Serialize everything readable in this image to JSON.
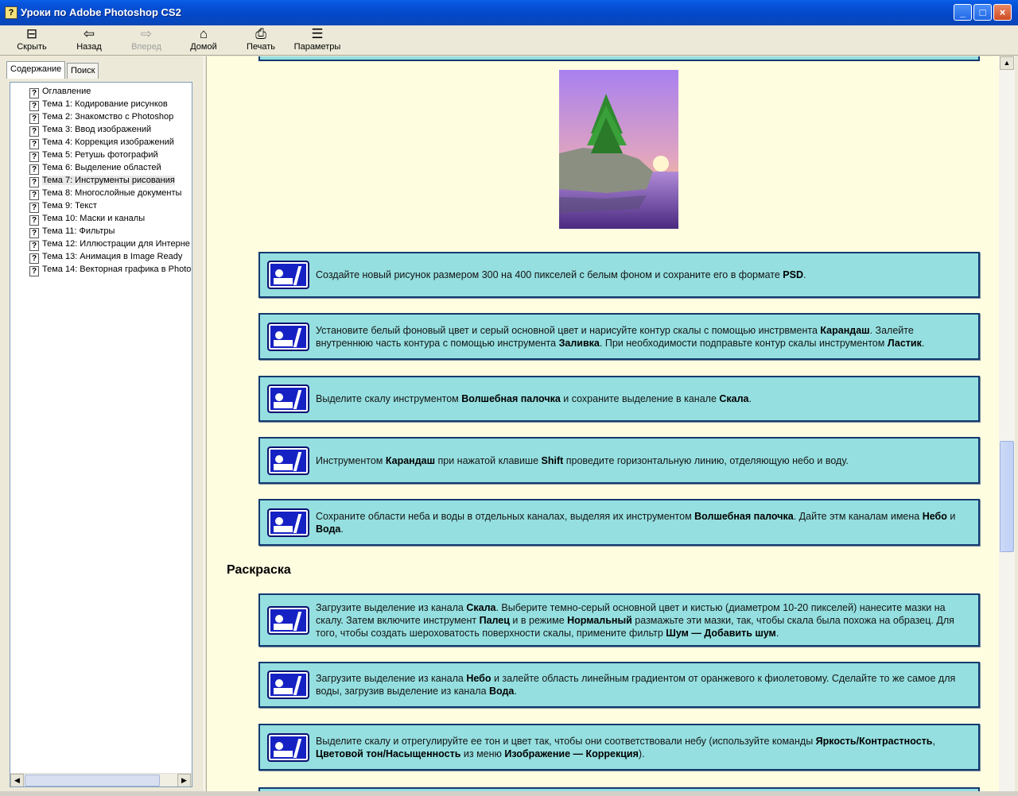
{
  "window": {
    "title": "Уроки по Adobe Photoshop CS2"
  },
  "toolbar": {
    "hide": "Скрыть",
    "back": "Назад",
    "forward": "Вперед",
    "home": "Домой",
    "print": "Печать",
    "options": "Параметры"
  },
  "tabs": {
    "contents": "Содержание",
    "search": "Поиск"
  },
  "tree": [
    "Оглавление",
    "Тема 1: Кодирование рисунков",
    "Тема 2: Знакомство с Photoshop",
    "Тема 3: Ввод изображений",
    "Тема 4: Коррекция изображений",
    "Тема 5: Ретушь фотографий",
    "Тема 6: Выделение областей",
    "Тема 7: Инструменты рисования",
    "Тема 8: Многослойные документы",
    "Тема 9: Текст",
    "Тема 10: Маски и каналы",
    "Тема 11: Фильтры",
    "Тема 12: Иллюстрации для Интерне",
    "Тема 13: Анимация в Image Ready",
    "Тема 14: Векторная графика в Photo"
  ],
  "content": {
    "heading": "Раскраска",
    "steps": [
      [
        "Создайте новый рисунок размером 300 на 400 пикселей с белым фоном и сохраните его в формате ",
        {
          "b": "PSD"
        },
        "."
      ],
      [
        "Установите белый фоновый цвет и серый основной цвет и нарисуйте контур скалы с помощью инстрвмента ",
        {
          "b": "Карандаш"
        },
        ". Залейте внутреннюю часть контура с помощью инструмента ",
        {
          "b": "Заливка"
        },
        ". При необходимости подправьте контур скалы инструментом ",
        {
          "b": "Ластик"
        },
        "."
      ],
      [
        "Выделите скалу инструментом ",
        {
          "b": "Волшебная палочка"
        },
        " и сохраните выделение в канале ",
        {
          "b": "Скала"
        },
        "."
      ],
      [
        "Инструментом ",
        {
          "b": "Карандаш"
        },
        " при нажатой клавише ",
        {
          "b": "Shift"
        },
        " проведите горизонтальную линию, отделяющую небо и воду."
      ],
      [
        "Сохраните области неба и воды в отдельных каналах, выделяя их инструментом ",
        {
          "b": "Волшебная палочка"
        },
        ". Дайте этм каналам имена ",
        {
          "b": "Небо"
        },
        " и ",
        {
          "b": "Вода"
        },
        "."
      ],
      [
        "Загрузите выделение из канала ",
        {
          "b": "Скала"
        },
        ". Выберите темно-серый основной цвет и кистью (диаметром 10-20 пикселей) нанесите мазки на скалу. Затем включите инструмент ",
        {
          "b": "Палец"
        },
        " и в режиме ",
        {
          "b": "Нормальный"
        },
        " размажьте эти мазки, так, чтобы скала была похожа на образец. Для того, чтобы создать шероховатость поверхности скалы, примените фильтр ",
        {
          "b": "Шум — Добавить шум"
        },
        "."
      ],
      [
        "Загрузите выделение из канала ",
        {
          "b": "Небо"
        },
        " и залейте область линейным градиентом от оранжевого к фиолетовому. Сделайте то же самое для воды, загрузив выделение из канала ",
        {
          "b": "Вода"
        },
        "."
      ],
      [
        "Выделите скалу и отрегулируйте ее тон и цвет так, чтобы они соответствовали небу (используйте команды ",
        {
          "b": "Яркость/Контрастность"
        },
        ", ",
        {
          "b": "Цветовой тон/Насыщенность"
        },
        " из меню ",
        {
          "b": "Изображение — Коррекция"
        },
        ")."
      ]
    ]
  },
  "colors": {
    "box_bg": "#95dfe0",
    "box_border": "#143a6e",
    "content_bg": "#fffde0",
    "titlebar": "#0653d8"
  }
}
